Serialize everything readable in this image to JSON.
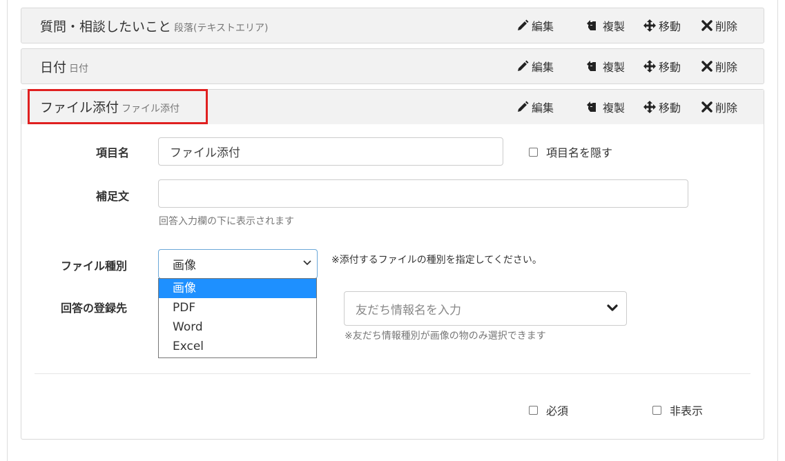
{
  "blocks": [
    {
      "title": "質問・相談したいこと",
      "subtitle": "段落(テキストエリア)",
      "actions": {
        "edit": "編集",
        "duplicate": "複製",
        "move": "移動",
        "delete": "削除"
      }
    },
    {
      "title": "日付",
      "subtitle": "日付",
      "actions": {
        "edit": "編集",
        "duplicate": "複製",
        "move": "移動",
        "delete": "削除"
      }
    },
    {
      "title": "ファイル添付",
      "subtitle": "ファイル添付",
      "actions": {
        "edit": "編集",
        "duplicate": "複製",
        "move": "移動",
        "delete": "削除"
      }
    }
  ],
  "form": {
    "item_name_label": "項目名",
    "item_name_value": "ファイル添付",
    "hide_item_name_label": "項目名を隠す",
    "supplement_label": "補足文",
    "supplement_value": "",
    "supplement_help": "回答入力欄の下に表示されます",
    "file_type_label": "ファイル種別",
    "file_type_selected": "画像",
    "file_type_note": "※添付するファイルの種別を指定してください。",
    "file_type_options": [
      "画像",
      "PDF",
      "Word",
      "Excel"
    ],
    "answer_destination_label": "回答の登録先",
    "friend_info_placeholder": "友だち情報名を入力",
    "friend_info_note": "※友だち情報種別が画像の物のみ選択できます",
    "required_label": "必須",
    "hidden_label": "非表示"
  },
  "colors": {
    "highlight_border": "#e02020",
    "selected_option_bg": "#1e90ff",
    "header_bg": "#f2f2f2"
  },
  "icons": {
    "edit": "pencil-icon",
    "duplicate": "duplicate-icon",
    "move": "move-arrows-icon",
    "delete": "x-icon"
  }
}
